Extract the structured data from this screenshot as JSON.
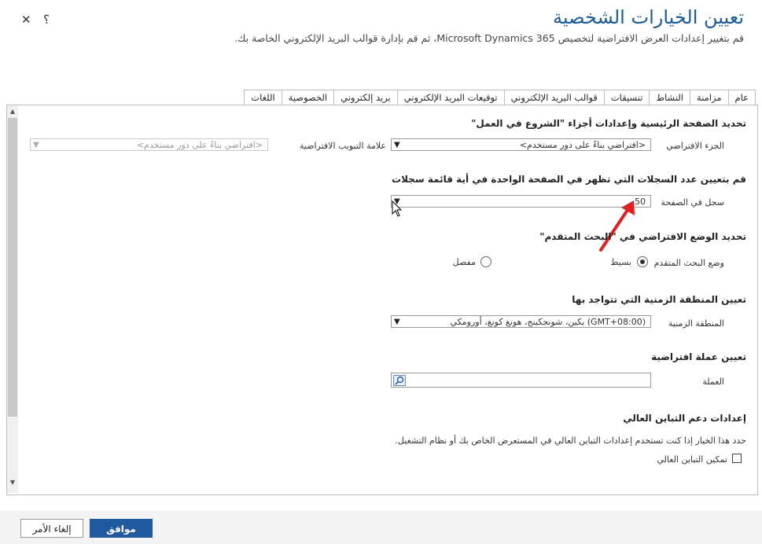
{
  "header": {
    "title": "تعيين الخيارات الشخصية",
    "subtitle": "قم بتغيير إعدادات العرض الافتراضية لتخصيص Microsoft Dynamics 365، ثم قم بإدارة قوالب البريد الإلكتروني الخاصة بك.",
    "close_glyph": "✕",
    "help_glyph": "؟"
  },
  "tabs": [
    {
      "label": "عام",
      "active": true
    },
    {
      "label": "مزامنة"
    },
    {
      "label": "النشاط"
    },
    {
      "label": "تنسيقات"
    },
    {
      "label": "قوالب البريد الإلكتروني"
    },
    {
      "label": "توقيعات البريد الإلكتروني"
    },
    {
      "label": "بريد إلكتروني"
    },
    {
      "label": "الخصوصية"
    },
    {
      "label": "اللغات"
    }
  ],
  "sections": {
    "home": {
      "heading": "تحديد الصفحة الرئيسية وإعدادات أجزاء \"الشروع في العمل\"",
      "default_pane_label": "الجزء الافتراضي",
      "default_pane_value": "<افتراضي بناءً على دور مستخدم>",
      "default_tab_label": "علامة التبويب الافتراضية",
      "default_tab_value": "<افتراضي بناءً على دور مستخدم>"
    },
    "records": {
      "heading": "قم بتعيين عدد السجلات التي تظهر في الصفحة الواحدة في أية قائمة سجلات",
      "per_page_label": "سجل في الصفحة",
      "per_page_value": "50"
    },
    "advanced_find": {
      "heading": "تحديد الوضع الافتراضي في \"البحث المتقدم\"",
      "mode_label": "وضع البحث المتقدم",
      "simple_label": "بسيط",
      "detailed_label": "مفصل",
      "selected": "simple"
    },
    "timezone": {
      "heading": "تعيين المنطقة الزمنية التي تتواجد بها",
      "label": "المنطقة الزمنية",
      "value": "(GMT+08:00) بكين، شونجكينج، هونغ كونغ، أورومكي"
    },
    "currency": {
      "heading": "تعيين عملة افتراضية",
      "label": "العملة",
      "value": ""
    },
    "contrast": {
      "heading": "إعدادات دعم التباين العالي",
      "description": "حدد هذا الخيار إذا كنت تستخدم إعدادات التباين العالي في المستعرض الخاص بك أو نظام التشغيل.",
      "checkbox_label": "تمكين التباين العالي",
      "checked": false
    }
  },
  "footer": {
    "ok_label": "موافق",
    "cancel_label": "إلغاء الأمر"
  },
  "colors": {
    "title": "#1a5a96",
    "primary_button": "#1f5aa0",
    "annotation_arrow": "#e02020"
  }
}
